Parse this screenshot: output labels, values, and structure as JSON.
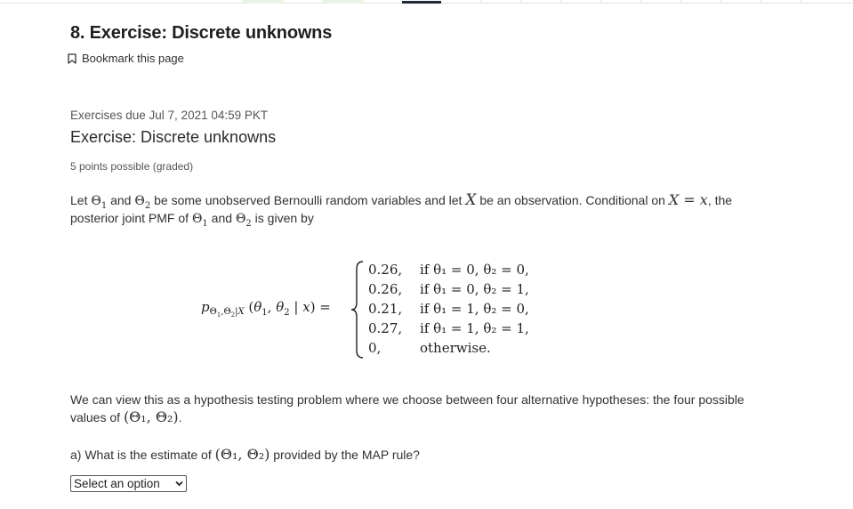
{
  "page": {
    "title": "8. Exercise: Discrete unknowns",
    "bookmark_label": "Bookmark this page"
  },
  "problem": {
    "due": "Exercises due Jul 7, 2021 04:59 PKT",
    "title": "Exercise: Discrete unknowns",
    "points": "5 points possible (graded)",
    "intro": {
      "t1": "Let ",
      "t2": " and ",
      "t3": " be some unobserved Bernoulli random variables and let ",
      "t4": " be an observation. Conditional on ",
      "t5": ", the",
      "line2_a": "posterior joint PMF of ",
      "line2_b": " and ",
      "line2_c": " is given by"
    },
    "equation": {
      "lhs": "p",
      "cases": [
        {
          "value": "0.26,",
          "condition": "if θ₁ = 0, θ₂ = 0,"
        },
        {
          "value": "0.26,",
          "condition": "if θ₁ = 0, θ₂ = 1,"
        },
        {
          "value": "0.21,",
          "condition": "if θ₁ = 1, θ₂ = 0,"
        },
        {
          "value": "0.27,",
          "condition": "if θ₁ = 1, θ₂ = 1,"
        },
        {
          "value": "0,",
          "condition": "otherwise."
        }
      ]
    },
    "hypothesis_text": {
      "line1": "We can view this as a hypothesis testing problem where we choose between four alternative hypotheses: the four possible",
      "line2": "values of "
    },
    "question_a": {
      "t1": "a) What is the estimate of ",
      "t2": " provided by the MAP rule?",
      "select_value": "Select an option"
    }
  },
  "math": {
    "theta1": "Θ",
    "theta2": "Θ",
    "sub1": "1",
    "sub2": "2",
    "X": "X",
    "X_eq_x": "X = x",
    "pair": "(Θ₁, Θ₂)"
  }
}
